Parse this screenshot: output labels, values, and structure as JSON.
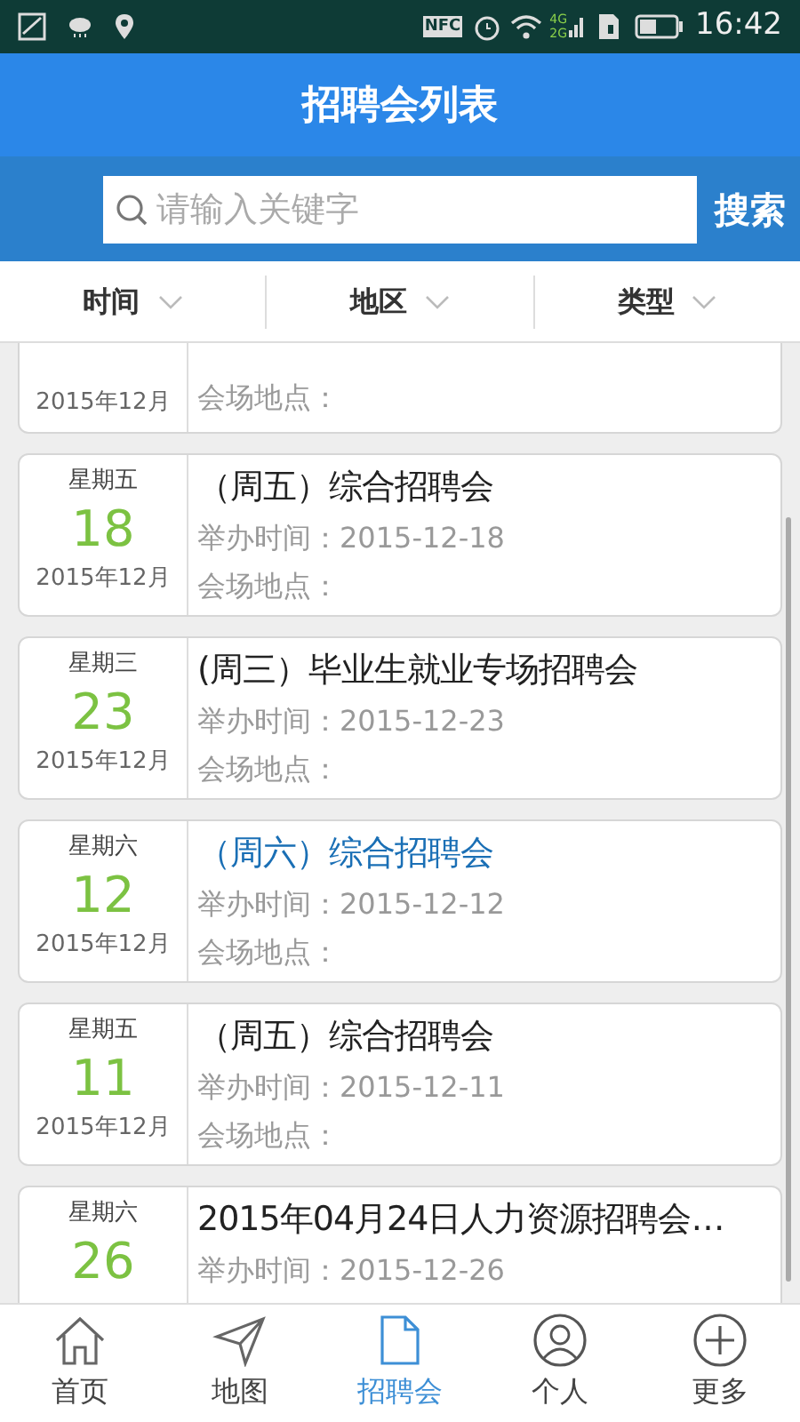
{
  "status_bar": {
    "time": "16:42",
    "nfc": "NFC",
    "net_top": "4G",
    "net_bottom": "2G"
  },
  "header": {
    "title": "招聘会列表"
  },
  "search": {
    "placeholder": "请输入关键字",
    "button": "搜索"
  },
  "filters": [
    {
      "label": "时间"
    },
    {
      "label": "地区"
    },
    {
      "label": "类型"
    }
  ],
  "fairs": [
    {
      "kind": "partial",
      "month": "2015年12月",
      "venue_label": "会场地点：",
      "selected": false
    },
    {
      "kind": "full",
      "weekday": "星期五",
      "day": "18",
      "month": "2015年12月",
      "title": "（周五）综合招聘会",
      "time_label": "举办时间：",
      "date": "2015-12-18",
      "venue_label": "会场地点：",
      "selected": false
    },
    {
      "kind": "full",
      "weekday": "星期三",
      "day": "23",
      "month": "2015年12月",
      "title": "(周三）毕业生就业专场招聘会",
      "time_label": "举办时间：",
      "date": "2015-12-23",
      "venue_label": "会场地点：",
      "selected": false
    },
    {
      "kind": "full",
      "weekday": "星期六",
      "day": "12",
      "month": "2015年12月",
      "title": "（周六）综合招聘会",
      "time_label": "举办时间：",
      "date": "2015-12-12",
      "venue_label": "会场地点：",
      "selected": true
    },
    {
      "kind": "full",
      "weekday": "星期五",
      "day": "11",
      "month": "2015年12月",
      "title": "（周五）综合招聘会",
      "time_label": "举办时间：",
      "date": "2015-12-11",
      "venue_label": "会场地点：",
      "selected": false
    },
    {
      "kind": "cut",
      "weekday": "星期六",
      "day": "26",
      "title": "2015年04月24日人力资源招聘会…",
      "time_label": "举办时间：",
      "date": "2015-12-26",
      "selected": false
    }
  ],
  "nav": [
    {
      "label": "首页",
      "kind": "home",
      "selected": false
    },
    {
      "label": "地图",
      "kind": "map",
      "selected": false
    },
    {
      "label": "招聘会",
      "kind": "fairs",
      "selected": true
    },
    {
      "label": "个人",
      "kind": "profile",
      "selected": false
    },
    {
      "label": "更多",
      "kind": "more",
      "selected": false
    }
  ]
}
